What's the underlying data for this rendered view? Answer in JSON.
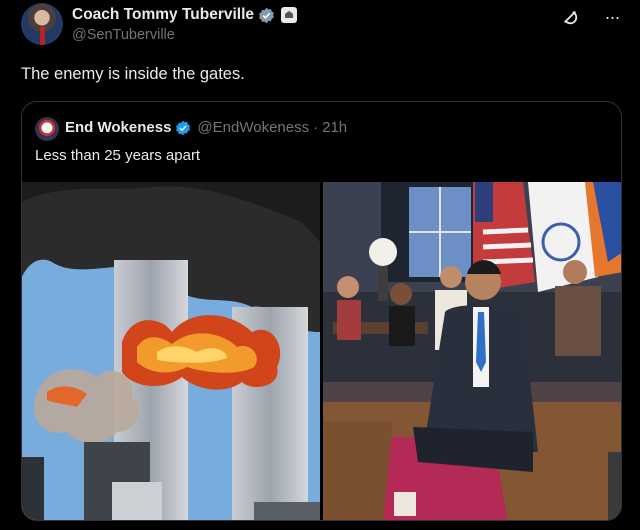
{
  "author": {
    "display_name": "Coach Tommy Tuberville",
    "handle": "@SenTuberville",
    "avatar_icon": "user-avatar-photo",
    "verified_icon": "verified-badge-icon",
    "badge_icon": "government-badge-icon"
  },
  "header_actions": {
    "grok_icon": "grok-icon",
    "more_icon": "more-options-icon",
    "more_label": "···"
  },
  "post": {
    "text": "The enemy is inside the gates."
  },
  "quoted_post": {
    "display_name": "End Wokeness",
    "handle": "@EndWokeness",
    "separator": "·",
    "time": "21h",
    "text": "Less than 25 years apart",
    "verified_color": "#1d9bf0",
    "media": [
      {
        "icon": "photo-burning-towers"
      },
      {
        "icon": "photo-indoor-gathering"
      }
    ]
  },
  "colors": {
    "background": "#000000",
    "text_primary": "#e7e9ea",
    "text_secondary": "#71767b",
    "border": "#2f3336",
    "verified": "#1d9bf0"
  }
}
